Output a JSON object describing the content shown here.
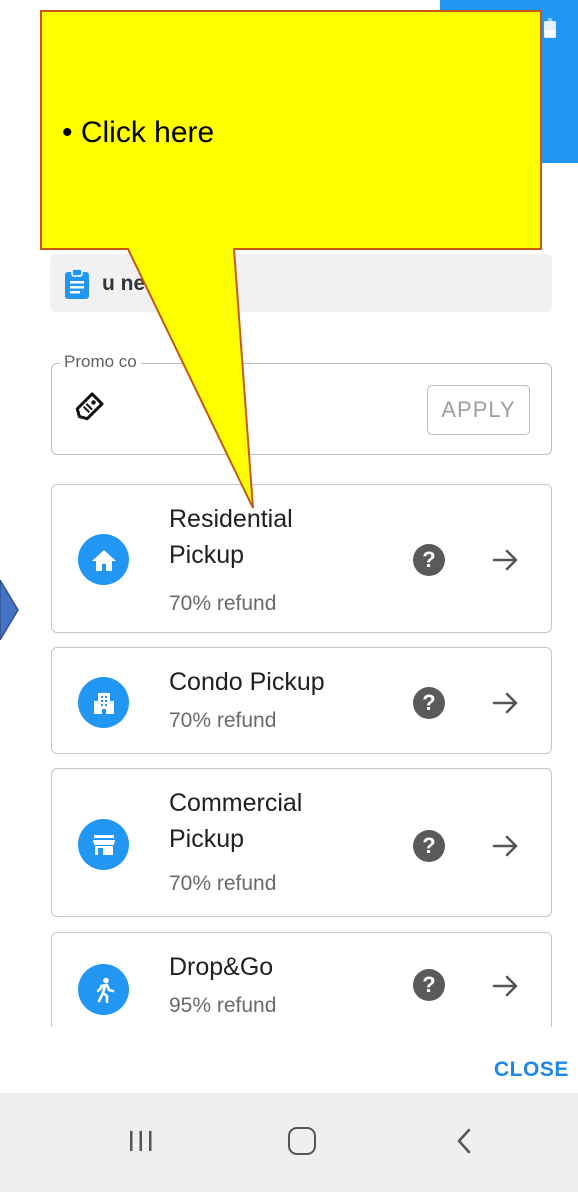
{
  "header": {
    "accent_color": "#2196f3"
  },
  "need_prompt": {
    "text": "u need?",
    "icon": "clipboard-icon"
  },
  "promo": {
    "label": "Promo co",
    "apply_label": "APPLY",
    "icon": "tag-icon"
  },
  "options": [
    {
      "title": "Residential Pickup",
      "refund": "70% refund",
      "icon": "home-icon"
    },
    {
      "title": "Condo Pickup",
      "refund": "70% refund",
      "icon": "building-icon"
    },
    {
      "title": "Commercial Pickup",
      "refund": "70% refund",
      "icon": "store-icon"
    },
    {
      "title": "Drop&Go",
      "refund": "95% refund",
      "icon": "walk-icon"
    }
  ],
  "help_glyph": "?",
  "close_label": "CLOSE",
  "callout": {
    "text": "• Click here",
    "color": "#ffff00",
    "border_color": "#c55a11"
  }
}
